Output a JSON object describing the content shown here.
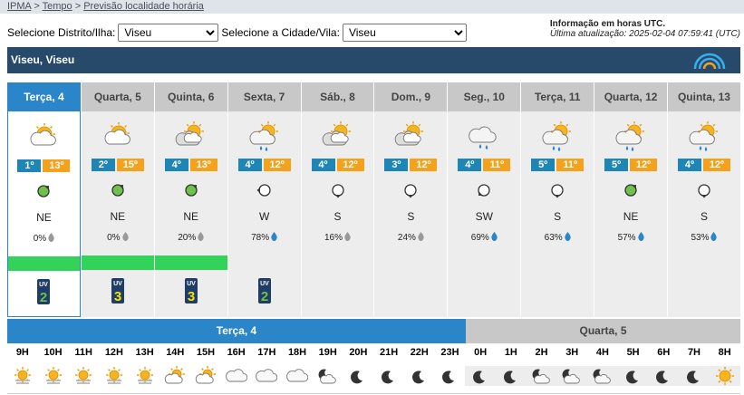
{
  "breadcrumb": {
    "home": "IPMA",
    "sep1": " > ",
    "tempo": "Tempo",
    "sep2": " > ",
    "page": "Previsão localidade horária"
  },
  "selectors": {
    "district_label": "Selecione Distrito/Ilha:",
    "district_value": "Viseu",
    "city_label": "Selecione a Cidade/Vila:",
    "city_value": "Viseu"
  },
  "info": {
    "line1": "Informação em horas UTC.",
    "line2": "Última atualização: 2025-02-04 07:59:41 (UTC)"
  },
  "location": {
    "title": "Viseu, Viseu"
  },
  "colors": {
    "accent": "#2a86c8",
    "header_bar": "#274a6b",
    "tmin": "#1d86b6",
    "tmax": "#f4a21c",
    "uv_bar": "#33d35a"
  },
  "days": [
    {
      "label": "Terça, 4",
      "tmin": "1º",
      "tmax": "13º",
      "wind": "NE",
      "prec": "0%",
      "icon": "sun-cloud-icon",
      "uv": "2",
      "uv_bar": true,
      "today": true
    },
    {
      "label": "Quarta, 5",
      "tmin": "2º",
      "tmax": "15º",
      "wind": "NE",
      "prec": "0%",
      "icon": "sun-cloud-icon",
      "uv": "3",
      "uv_bar": true
    },
    {
      "label": "Quinta, 6",
      "tmin": "4º",
      "tmax": "13º",
      "wind": "NE",
      "prec": "20%",
      "icon": "sun-clouds-icon",
      "uv": "3",
      "uv_bar": true
    },
    {
      "label": "Sexta, 7",
      "tmin": "4º",
      "tmax": "12º",
      "wind": "W",
      "prec": "78%",
      "icon": "sun-rain-icon",
      "uv": "2",
      "uv_bar": false
    },
    {
      "label": "Sáb., 8",
      "tmin": "4º",
      "tmax": "12º",
      "wind": "S",
      "prec": "16%",
      "icon": "sun-clouds-icon",
      "uv": "",
      "uv_bar": false
    },
    {
      "label": "Dom., 9",
      "tmin": "3º",
      "tmax": "12º",
      "wind": "S",
      "prec": "24%",
      "icon": "sun-clouds-icon",
      "uv": "",
      "uv_bar": false
    },
    {
      "label": "Seg., 10",
      "tmin": "4º",
      "tmax": "11º",
      "wind": "SW",
      "prec": "69%",
      "icon": "cloud-rain-icon",
      "uv": "",
      "uv_bar": false
    },
    {
      "label": "Terça, 11",
      "tmin": "5º",
      "tmax": "11º",
      "wind": "S",
      "prec": "63%",
      "icon": "sun-rain-icon",
      "uv": "",
      "uv_bar": false
    },
    {
      "label": "Quarta, 12",
      "tmin": "5º",
      "tmax": "12º",
      "wind": "NE",
      "prec": "57%",
      "icon": "sun-rain-icon",
      "uv": "",
      "uv_bar": false
    },
    {
      "label": "Quinta, 13",
      "tmin": "4º",
      "tmax": "12º",
      "wind": "S",
      "prec": "53%",
      "icon": "sun-rain-icon",
      "uv": "",
      "uv_bar": false
    }
  ],
  "tabs": {
    "current": "Terça, 4",
    "next": "Quarta, 5"
  },
  "hours": [
    {
      "h": "9H",
      "icon": "haze-sun-icon"
    },
    {
      "h": "10H",
      "icon": "haze-sun-icon"
    },
    {
      "h": "11H",
      "icon": "haze-sun-icon"
    },
    {
      "h": "12H",
      "icon": "haze-sun-icon"
    },
    {
      "h": "13H",
      "icon": "haze-sun-icon"
    },
    {
      "h": "14H",
      "icon": "sun-cloud-icon"
    },
    {
      "h": "15H",
      "icon": "sun-cloud-icon"
    },
    {
      "h": "16H",
      "icon": "cloud-icon"
    },
    {
      "h": "17H",
      "icon": "cloud-icon"
    },
    {
      "h": "18H",
      "icon": "cloud-icon"
    },
    {
      "h": "19H",
      "icon": "moon-cloud-icon"
    },
    {
      "h": "20H",
      "icon": "moon-icon"
    },
    {
      "h": "21H",
      "icon": "moon-icon"
    },
    {
      "h": "22H",
      "icon": "moon-icon"
    },
    {
      "h": "23H",
      "icon": "moon-icon"
    },
    {
      "h": "0H",
      "icon": "moon-icon"
    },
    {
      "h": "1H",
      "icon": "moon-icon"
    },
    {
      "h": "2H",
      "icon": "moon-cloud-icon"
    },
    {
      "h": "3H",
      "icon": "moon-cloud-icon"
    },
    {
      "h": "4H",
      "icon": "moon-cloud-icon"
    },
    {
      "h": "5H",
      "icon": "moon-icon"
    },
    {
      "h": "6H",
      "icon": "moon-icon"
    },
    {
      "h": "7H",
      "icon": "moon-icon"
    },
    {
      "h": "8H",
      "icon": "sun-icon"
    }
  ]
}
